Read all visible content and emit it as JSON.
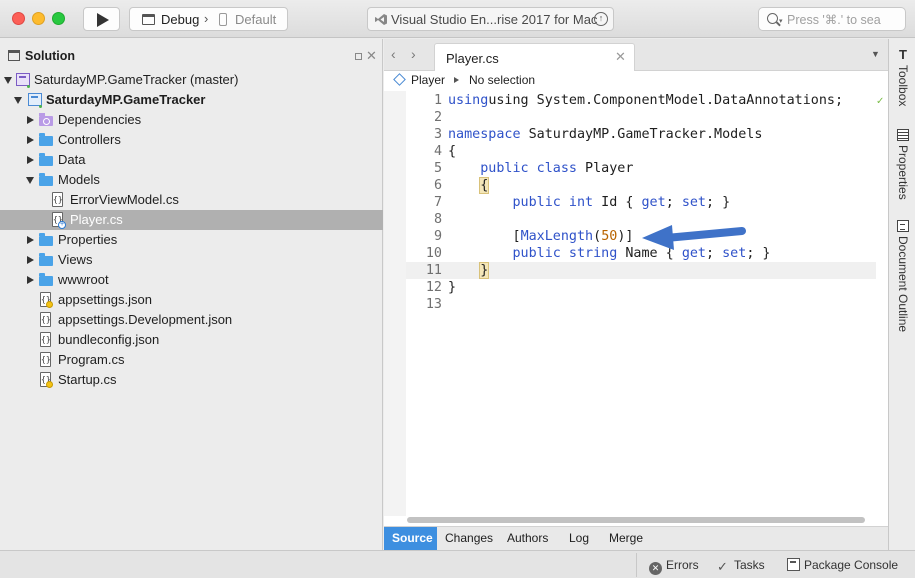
{
  "toolbar": {
    "config": "Debug",
    "device": "Default",
    "status_text": "Visual Studio En...rise 2017 for Mac",
    "search_placeholder": "Press '⌘.' to sea"
  },
  "solution_pad": {
    "title": "Solution",
    "items": [
      {
        "label": "SaturdayMP.GameTracker (master)",
        "icon": "solution-icon",
        "expanded": true
      },
      {
        "label": "SaturdayMP.GameTracker",
        "icon": "project-icon",
        "expanded": true
      },
      {
        "label": "Dependencies",
        "icon": "dependencies-icon"
      },
      {
        "label": "Controllers",
        "icon": "folder-icon"
      },
      {
        "label": "Data",
        "icon": "folder-icon"
      },
      {
        "label": "Models",
        "icon": "folder-icon",
        "expanded": true
      },
      {
        "label": "ErrorViewModel.cs",
        "icon": "file-icon"
      },
      {
        "label": "Player.cs",
        "icon": "file-icon",
        "selected": true
      },
      {
        "label": "Properties",
        "icon": "folder-icon"
      },
      {
        "label": "Views",
        "icon": "folder-icon"
      },
      {
        "label": "wwwroot",
        "icon": "folder-icon"
      },
      {
        "label": "appsettings.json",
        "icon": "file-icon"
      },
      {
        "label": "appsettings.Development.json",
        "icon": "file-icon"
      },
      {
        "label": "bundleconfig.json",
        "icon": "file-icon"
      },
      {
        "label": "Program.cs",
        "icon": "file-icon"
      },
      {
        "label": "Startup.cs",
        "icon": "file-icon"
      }
    ]
  },
  "editor": {
    "tab_label": "Player.cs",
    "path": {
      "class": "Player",
      "member": "No selection"
    },
    "lines": [
      {
        "n": "1",
        "t1": "using System.ComponentModel.DataAnnotations;"
      },
      {
        "n": "2"
      },
      {
        "n": "3",
        "kw": "namespace",
        "t1": " SaturdayMP.GameTracker.Models"
      },
      {
        "n": "4",
        "t1": "{"
      },
      {
        "n": "5",
        "kw": "public class",
        "t1": " Player"
      },
      {
        "n": "6",
        "t1": "{"
      },
      {
        "n": "7",
        "kw": "public int",
        "t1": " Id { ",
        "kw2": "get",
        "t2": "; ",
        "kw3": "set",
        "t3": "; }"
      },
      {
        "n": "8"
      },
      {
        "n": "9",
        "attr": "MaxLength",
        "num": "50"
      },
      {
        "n": "10",
        "kw": "public string",
        "t1": " Name { ",
        "kw2": "get",
        "t2": "; ",
        "kw3": "set",
        "t3": "; }"
      },
      {
        "n": "11",
        "t1": "}"
      },
      {
        "n": "12",
        "t1": "}"
      },
      {
        "n": "13"
      }
    ]
  },
  "bottom_tabs": [
    "Source",
    "Changes",
    "Authors",
    "Log",
    "Merge"
  ],
  "dock": [
    "Toolbox",
    "Properties",
    "Document Outline"
  ],
  "statusbar": {
    "errors": "Errors",
    "tasks": "Tasks",
    "console": "Package Console"
  },
  "colors": {
    "keyword": "#2f52c9",
    "number": "#b86400",
    "accent": "#3d8fe0",
    "arrow": "#3f72c8"
  }
}
